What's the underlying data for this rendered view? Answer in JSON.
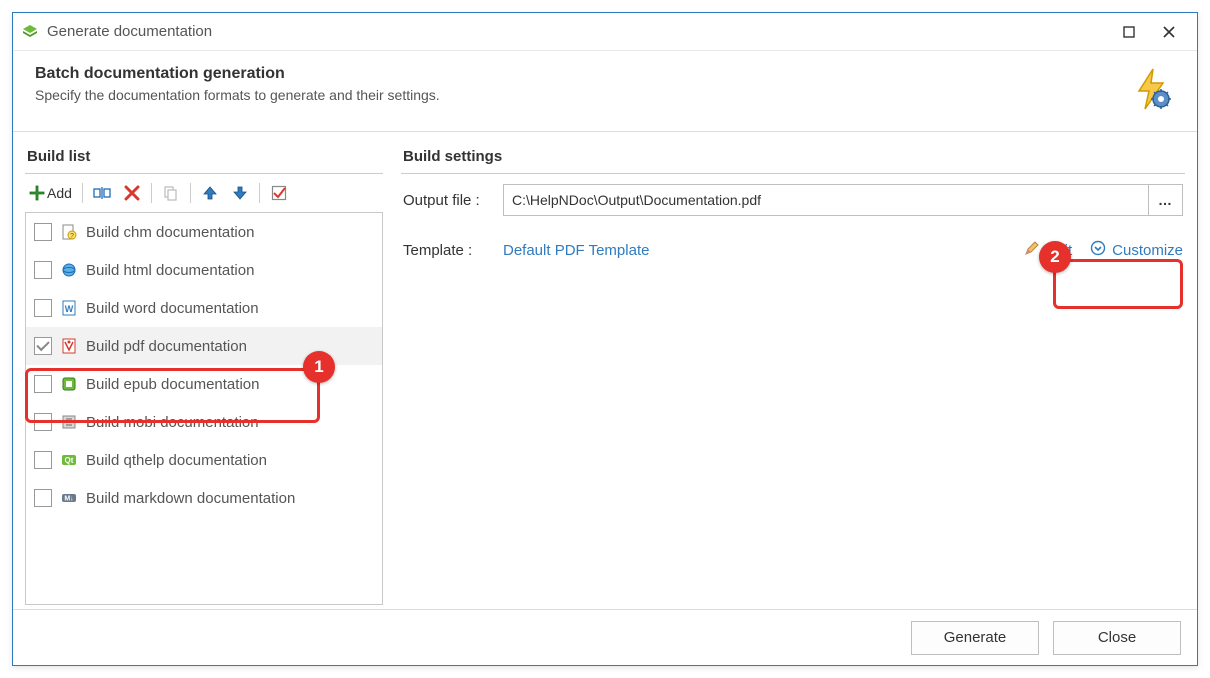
{
  "window": {
    "title": "Generate documentation"
  },
  "header": {
    "title": "Batch documentation generation",
    "subtitle": "Specify the documentation formats to generate and their settings."
  },
  "left": {
    "title": "Build list",
    "add_label": "Add",
    "items": [
      {
        "label": "Build chm documentation",
        "checked": false
      },
      {
        "label": "Build html documentation",
        "checked": false
      },
      {
        "label": "Build word documentation",
        "checked": false
      },
      {
        "label": "Build pdf documentation",
        "checked": true,
        "selected": true
      },
      {
        "label": "Build epub documentation",
        "checked": false
      },
      {
        "label": "Build mobi documentation",
        "checked": false
      },
      {
        "label": "Build qthelp documentation",
        "checked": false
      },
      {
        "label": "Build markdown documentation",
        "checked": false
      }
    ]
  },
  "right": {
    "title": "Build settings",
    "output_label": "Output file :",
    "output_value": "C:\\HelpNDoc\\Output\\Documentation.pdf",
    "browse_symbol": "…",
    "template_label": "Template :",
    "template_name": "Default PDF Template",
    "edit_label": "Edit",
    "customize_label": "Customize"
  },
  "footer": {
    "generate": "Generate",
    "close": "Close"
  },
  "annotations": {
    "badge1": "1",
    "badge2": "2"
  }
}
